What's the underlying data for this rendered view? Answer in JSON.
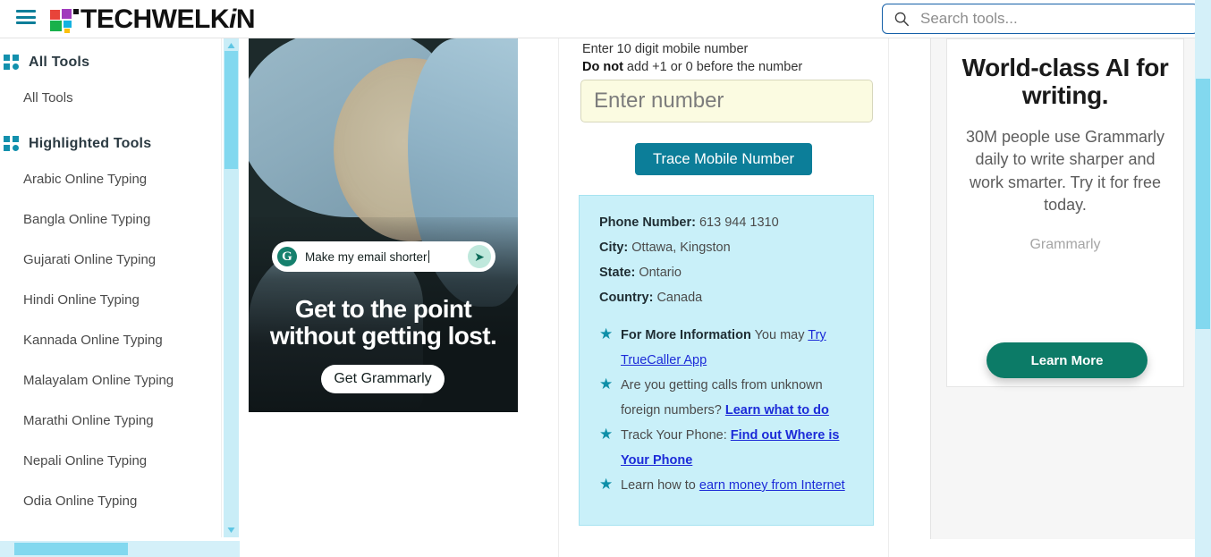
{
  "header": {
    "menu_icon": "hamburger-icon",
    "logo_text_main": "TECHWELK",
    "logo_text_italic": "i",
    "logo_text_end": "N",
    "search_placeholder": "Search tools...",
    "search_value": "",
    "search_icon": "search-icon"
  },
  "sidebar": {
    "sections": [
      {
        "icon": "grid-icon",
        "title": "All Tools",
        "items": [
          "All Tools"
        ]
      },
      {
        "icon": "grid-icon",
        "title": "Highlighted Tools",
        "items": [
          "Arabic Online Typing",
          "Bangla Online Typing",
          "Gujarati Online Typing",
          "Hindi Online Typing",
          "Kannada Online Typing",
          "Malayalam Online Typing",
          "Marathi Online Typing",
          "Nepali Online Typing",
          "Odia Online Typing"
        ]
      }
    ]
  },
  "image_ad": {
    "prompt_text": "Make my email shorter",
    "brand_initial": "G",
    "send_icon": "send-icon",
    "headline_line1": "Get to the point",
    "headline_line2": "without getting lost.",
    "cta_label": "Get Grammarly"
  },
  "form": {
    "note_line1": "Enter 10 digit mobile number",
    "note_bold": "Do not",
    "note_line2": " add +1 or 0 before the number",
    "input_placeholder": "Enter number",
    "input_value": "",
    "submit_label": "Trace Mobile Number"
  },
  "result": {
    "fields": [
      {
        "label": "Phone Number:",
        "value": "613 944 1310"
      },
      {
        "label": "City:",
        "value": "Ottawa, Kingston"
      },
      {
        "label": "State:",
        "value": "Ontario"
      },
      {
        "label": "Country:",
        "value": "Canada"
      }
    ],
    "bullets": [
      {
        "bold_lead": "For More Information",
        "text": " You may ",
        "link": "Try TrueCaller App",
        "link_bold": false,
        "tail": ""
      },
      {
        "bold_lead": "",
        "text": "Are you getting calls from unknown foreign numbers? ",
        "link": "Learn what to do",
        "link_bold": true,
        "tail": ""
      },
      {
        "bold_lead": "",
        "text": "Track Your Phone: ",
        "link": "Find out Where is Your Phone",
        "link_bold": true,
        "tail": ""
      },
      {
        "bold_lead": "",
        "text": "Learn how to ",
        "link": "earn money from Internet",
        "link_bold": false,
        "tail": ""
      }
    ],
    "star_icon": "star-icon"
  },
  "right_ad": {
    "title": "World-class AI for writing.",
    "body": "30M people use Grammarly daily to write sharper and work smarter. Try it for free today.",
    "brand": "Grammarly",
    "cta_label": "Learn More"
  },
  "colors": {
    "accent_teal": "#0c7e99",
    "result_bg": "#c9f0f9",
    "input_bg": "#fbfbe1",
    "grammarly_green": "#0c7b67",
    "scrollbar_track": "#d4f0f9",
    "scrollbar_thumb": "#82d8ef",
    "link_blue": "#1c2bd8"
  }
}
